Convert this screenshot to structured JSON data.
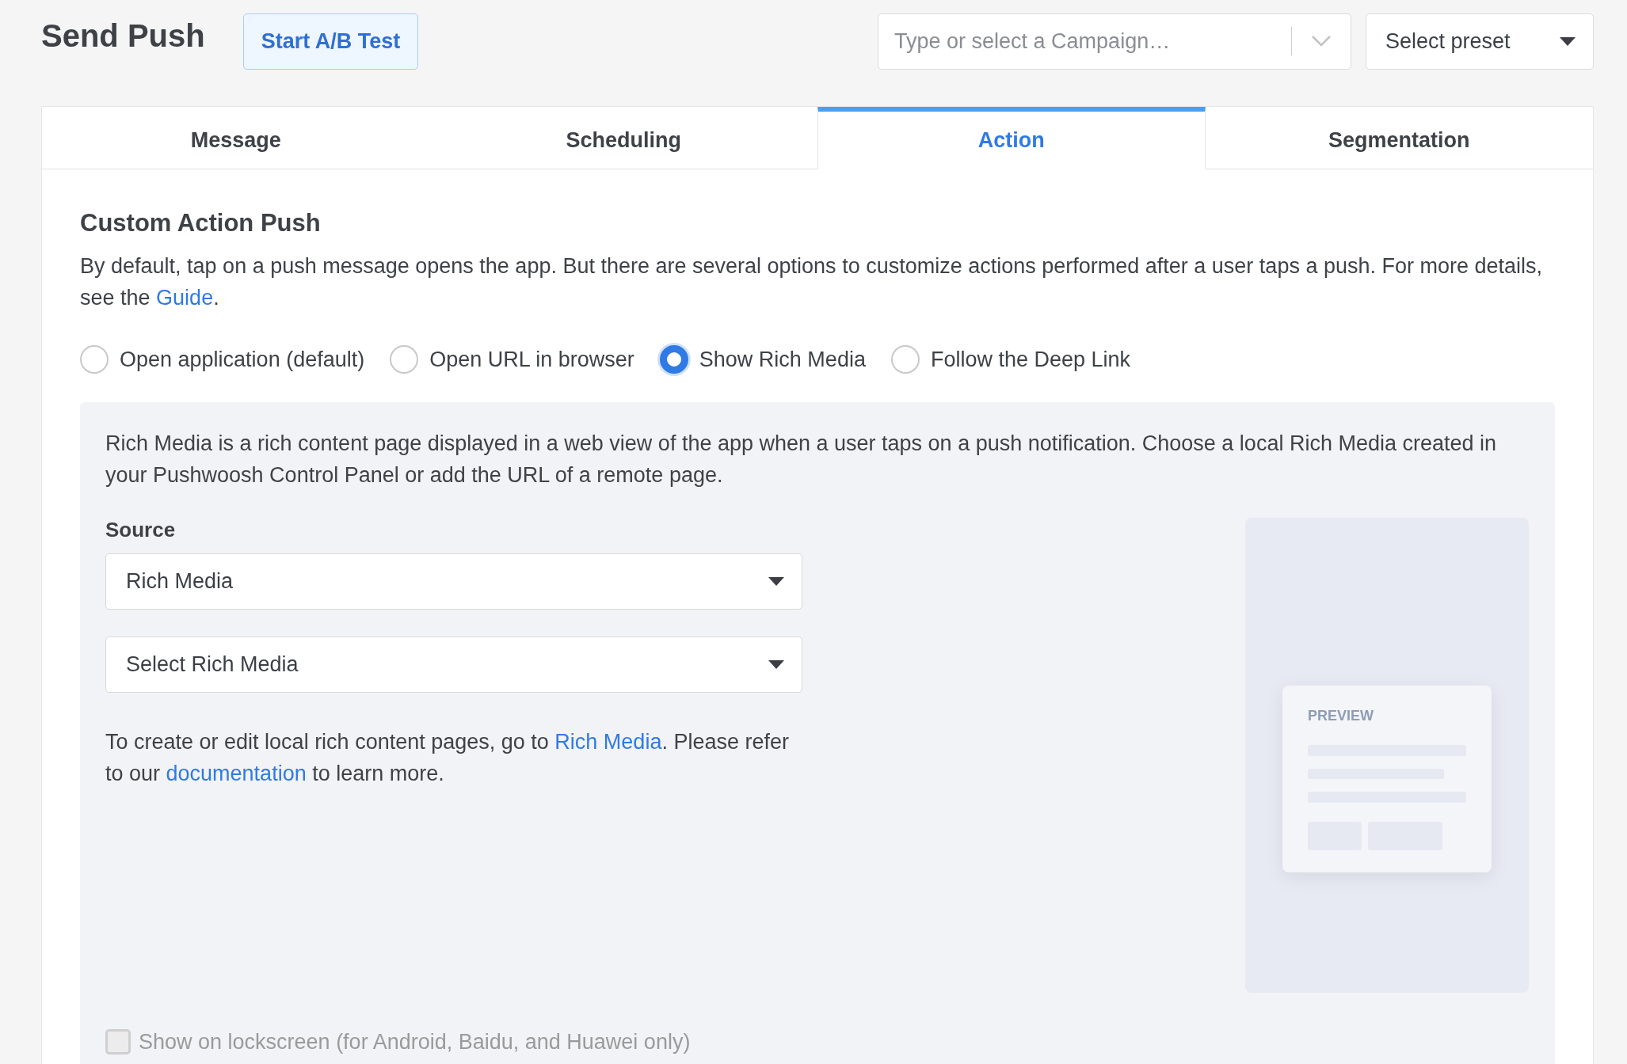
{
  "header": {
    "title": "Send Push",
    "ab_button": "Start A/B Test",
    "campaign": {
      "placeholder": "Type or select a Campaign…"
    },
    "preset": {
      "value": "Select preset"
    }
  },
  "tabs": [
    {
      "label": "Message",
      "selected": false
    },
    {
      "label": "Scheduling",
      "selected": false
    },
    {
      "label": "Action",
      "selected": true
    },
    {
      "label": "Segmentation",
      "selected": false
    }
  ],
  "section": {
    "heading": "Custom Action Push",
    "description": "By default, tap on a push message opens the app. But there are several options to customize actions performed after a user taps a push. For more details, see the",
    "description_link": "Guide",
    "description_end": "."
  },
  "actions": [
    {
      "label": "Open application (default)",
      "selected": false
    },
    {
      "label": "Open URL in browser",
      "selected": false
    },
    {
      "label": "Show Rich Media",
      "selected": true
    },
    {
      "label": "Follow the Deep Link",
      "selected": false
    }
  ],
  "rich_media": {
    "intro": "Rich Media is a rich content page displayed in a web view of the app when a user taps on a push notification. Choose a local Rich Media created in your Pushwoosh Control Panel or add the URL of a remote page.",
    "source_label": "Source",
    "source_value": "Rich Media",
    "select_value": "Select Rich Media",
    "help": [
      {
        "kind": "text",
        "text": "To create or edit local rich content pages, go to "
      },
      {
        "kind": "link",
        "text": "Rich Media"
      },
      {
        "kind": "text",
        "text": ". Please refer to our "
      },
      {
        "kind": "link",
        "text": "documentation"
      },
      {
        "kind": "text",
        "text": " to learn more."
      }
    ],
    "preview_label": "PREVIEW",
    "lockscreen": {
      "label": "Show on lockscreen (for Android, Baidu, and Huawei only)",
      "checked": false,
      "disabled": true
    }
  }
}
